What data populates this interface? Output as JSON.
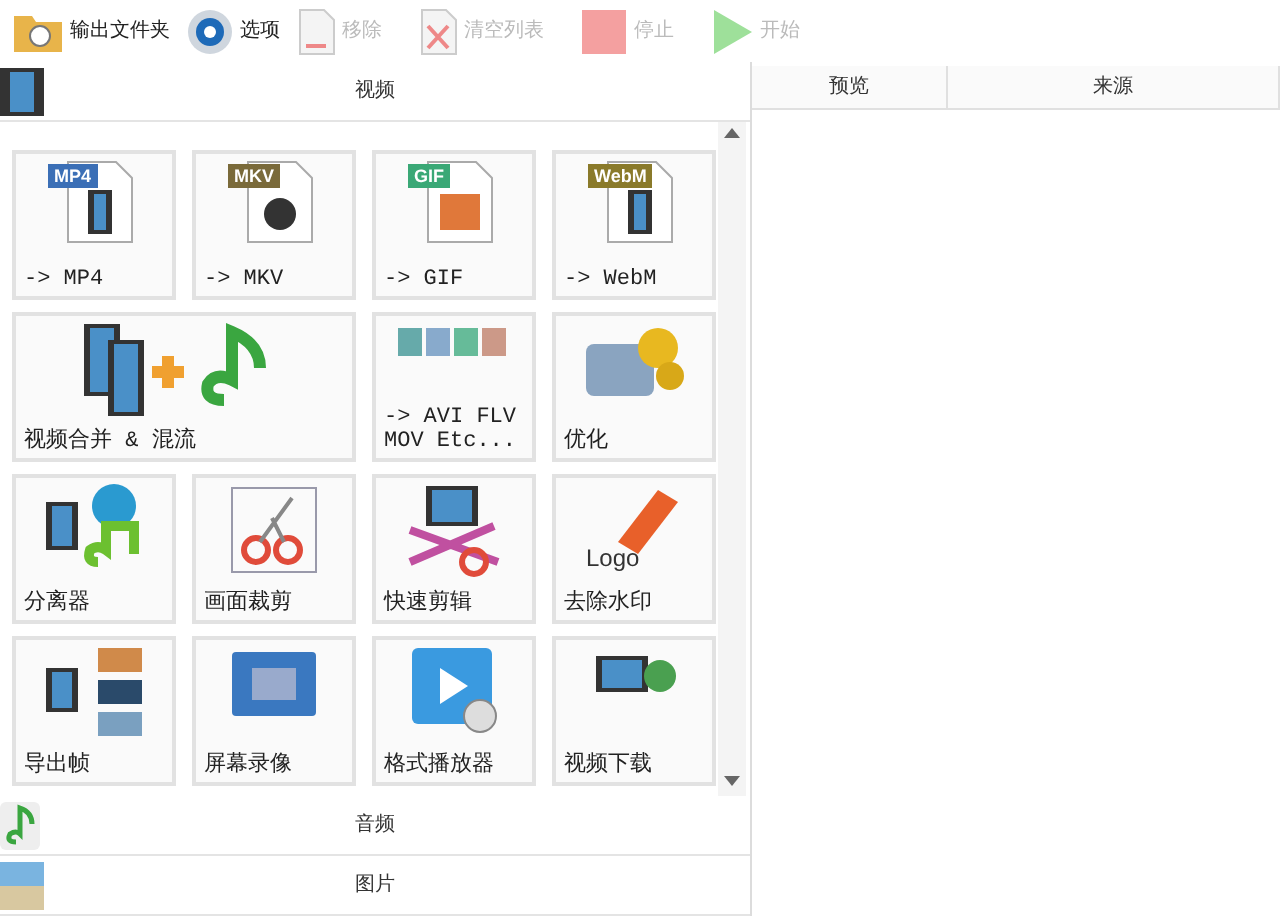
{
  "toolbar": [
    {
      "label": "输出文件夹",
      "disabled": false
    },
    {
      "label": "选项",
      "disabled": false
    },
    {
      "label": "移除",
      "disabled": true
    },
    {
      "label": "清空列表",
      "disabled": true
    },
    {
      "label": "停止",
      "disabled": true
    },
    {
      "label": "开始",
      "disabled": true
    }
  ],
  "sections": [
    {
      "title": "视频"
    },
    {
      "title": "音频"
    },
    {
      "title": "图片"
    }
  ],
  "tiles": [
    {
      "kind": "small",
      "label": "-> MP4",
      "tag": "MP4"
    },
    {
      "kind": "small",
      "label": "-> MKV",
      "tag": "MKV"
    },
    {
      "kind": "small",
      "label": "-> GIF",
      "tag": "GIF"
    },
    {
      "kind": "small",
      "label": "-> WebM",
      "tag": "WebM"
    },
    {
      "kind": "wide",
      "label": "视频合并 & 混流"
    },
    {
      "kind": "small",
      "label": "-> AVI FLV\nMOV Etc..."
    },
    {
      "kind": "small",
      "label": "优化"
    },
    {
      "kind": "small",
      "label": "分离器"
    },
    {
      "kind": "small",
      "label": "画面裁剪"
    },
    {
      "kind": "small",
      "label": "快速剪辑"
    },
    {
      "kind": "small",
      "label": "去除水印",
      "tag": "Logo"
    },
    {
      "kind": "small",
      "label": "导出帧"
    },
    {
      "kind": "small",
      "label": "屏幕录像"
    },
    {
      "kind": "small",
      "label": "格式播放器"
    },
    {
      "kind": "small",
      "label": "视频下载"
    }
  ],
  "table": {
    "columns": [
      "预览",
      "来源"
    ]
  }
}
